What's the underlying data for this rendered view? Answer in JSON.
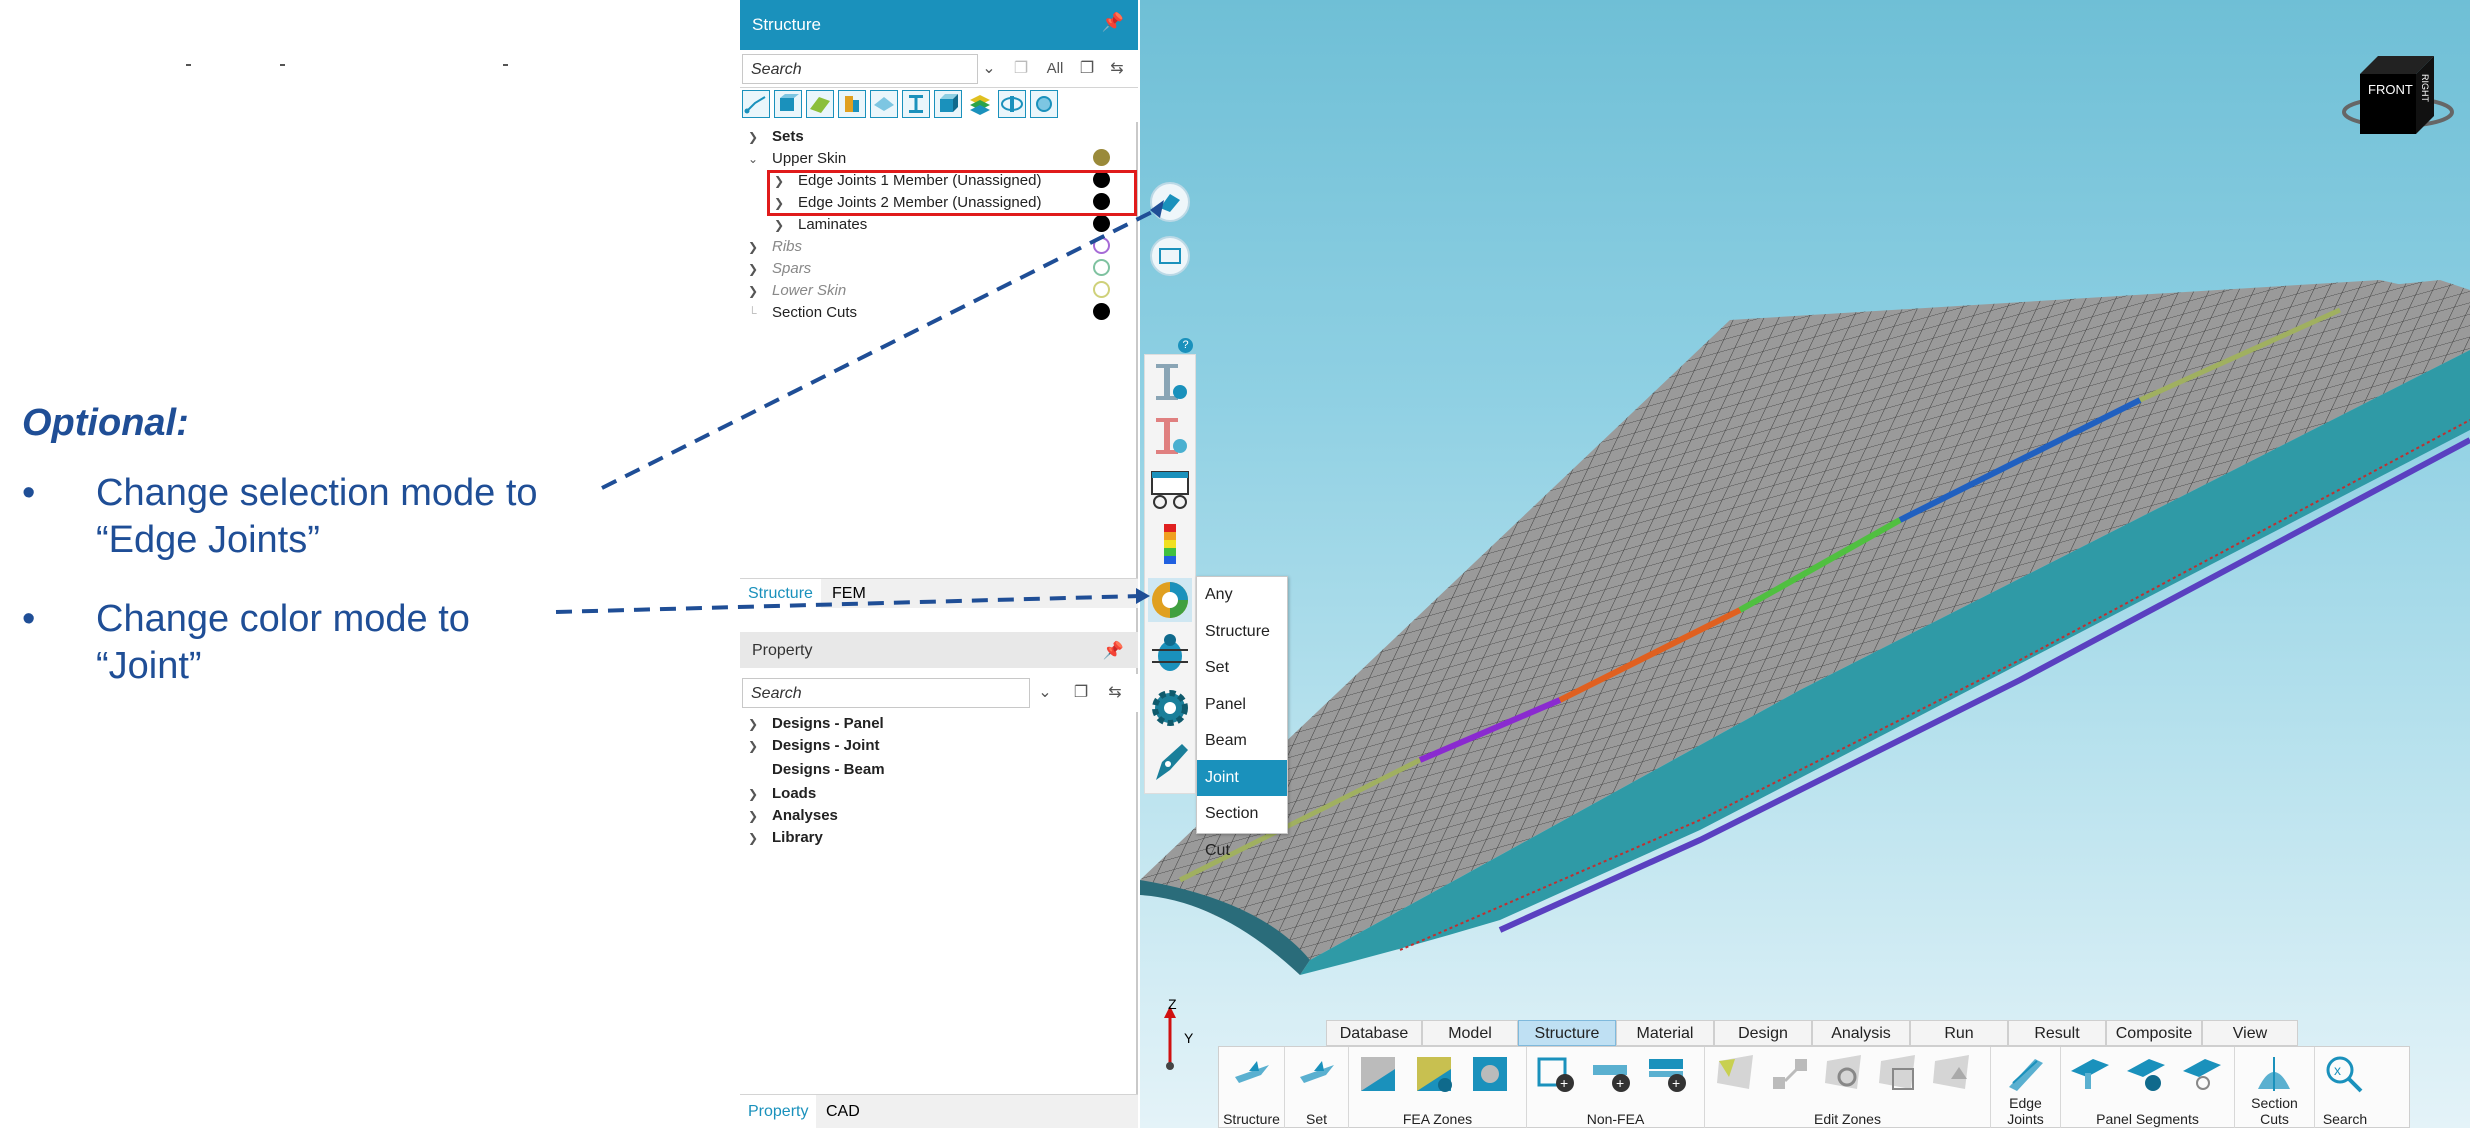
{
  "annotation": {
    "title": "Optional:",
    "bullet_char": "•",
    "bullets": [
      "Change selection mode to\n“Edge Joints”",
      "Change color mode to\n“Joint”"
    ]
  },
  "structure_panel": {
    "title": "Structure",
    "pin_icon": "pin-icon",
    "search_placeholder": "Search",
    "all_label": "All",
    "tree": [
      {
        "label": "Sets",
        "bold": true,
        "expander": "collapsed",
        "dot": null
      },
      {
        "label": "Upper Skin",
        "bold": false,
        "expander": "expanded",
        "dot": "#9a8a3a"
      },
      {
        "label": "Edge Joints 1 Member (Unassigned)",
        "bold": false,
        "expander": "collapsed",
        "dot": "#000000"
      },
      {
        "label": "Edge Joints 2 Member (Unassigned)",
        "bold": false,
        "expander": "collapsed",
        "dot": "#000000"
      },
      {
        "label": "Laminates",
        "bold": false,
        "expander": "collapsed",
        "dot": "#000000"
      },
      {
        "label": "Ribs",
        "italic": true,
        "expander": "collapsed",
        "dot_outline": "#a66bd6"
      },
      {
        "label": "Spars",
        "italic": true,
        "expander": "collapsed",
        "dot_outline": "#7fc2a0"
      },
      {
        "label": "Lower Skin",
        "italic": true,
        "expander": "collapsed",
        "dot_outline": "#cfd17a"
      },
      {
        "label": "Section Cuts",
        "bold": false,
        "expander": "none",
        "dot": "#000000"
      }
    ],
    "bottom_tabs": [
      "Structure",
      "FEM"
    ]
  },
  "property_panel": {
    "title": "Property",
    "search_placeholder": "Search",
    "tree": [
      {
        "label": "Designs - Panel",
        "expander": "collapsed"
      },
      {
        "label": "Designs - Joint",
        "expander": "collapsed"
      },
      {
        "label": "Designs - Beam",
        "expander": "none"
      },
      {
        "label": "Loads",
        "expander": "collapsed"
      },
      {
        "label": "Analyses",
        "expander": "collapsed"
      },
      {
        "label": "Library",
        "expander": "collapsed"
      }
    ],
    "bottom_tabs": [
      "Property",
      "CAD"
    ]
  },
  "color_mode_menu": {
    "items": [
      "Any",
      "Structure",
      "Set",
      "Panel",
      "Beam",
      "Joint",
      "Section Cut"
    ],
    "selected": "Joint"
  },
  "view_cube": {
    "front": "FRONT",
    "side": "RIGHT"
  },
  "axis": {
    "z": "Z",
    "y": "Y"
  },
  "ribbon": {
    "tabs": [
      "Database",
      "Model",
      "Structure",
      "Material",
      "Design",
      "Analysis",
      "Run",
      "Result",
      "Composite",
      "View"
    ],
    "active_tab": "Structure",
    "groups": [
      "Structure",
      "Set",
      "FEA Zones",
      "Non-FEA",
      "Edit Zones",
      "Edge Joints",
      "Panel Segments",
      "Section Cuts",
      "Search"
    ]
  },
  "colors": {
    "accent": "#1a91bc",
    "annotation": "#1f4e96",
    "highlight": "#e01b1b"
  }
}
